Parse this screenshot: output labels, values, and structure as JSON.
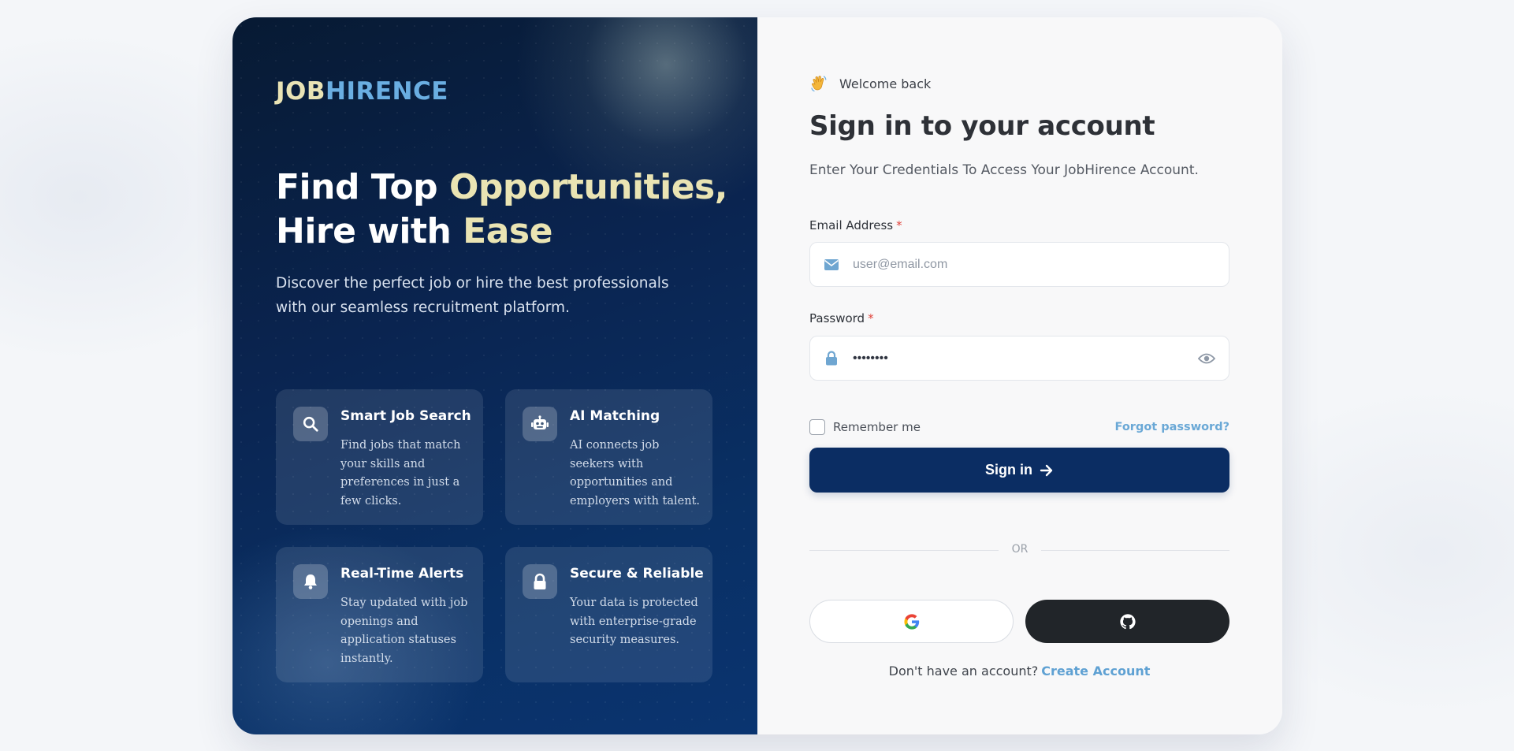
{
  "brand": {
    "part1": "JOB",
    "part2": "HIRENCE"
  },
  "hero": {
    "headline_line1_a": "Find Top ",
    "headline_line1_b": "Opportunities,",
    "headline_line2_a": "Hire with ",
    "headline_line2_b": "Ease",
    "subtext": "Discover the perfect job or hire the best professionals with our seamless recruitment platform."
  },
  "features": [
    {
      "icon": "search-icon",
      "title": "Smart Job Search",
      "desc": "Find jobs that match your skills and preferences in just a few clicks."
    },
    {
      "icon": "robot-icon",
      "title": "AI Matching",
      "desc": "AI connects job seekers with opportunities and employers with talent."
    },
    {
      "icon": "bell-icon",
      "title": "Real-Time Alerts",
      "desc": "Stay updated with job openings and application statuses instantly."
    },
    {
      "icon": "lock-icon",
      "title": "Secure & Reliable",
      "desc": "Your data is protected with enterprise-grade security measures."
    }
  ],
  "form": {
    "welcome_emoji": "👋",
    "welcome": "Welcome back",
    "title": "Sign in to your account",
    "subtitle": "Enter Your Credentials To Access Your JobHirence Account.",
    "email_label": "Email Address",
    "email_placeholder": "user@email.com",
    "password_label": "Password",
    "password_value": "••••••••",
    "required_marker": "*",
    "remember_label": "Remember me",
    "forgot_label": "Forgot password?",
    "signin_label": "Sign in",
    "divider_label": "OR",
    "signup_prompt": "Don't have an account?",
    "signup_link": "Create Account"
  },
  "colors": {
    "primary": "#0b2d63",
    "accent": "#6aaee2",
    "highlight": "#eae4b3",
    "github": "#212529"
  }
}
